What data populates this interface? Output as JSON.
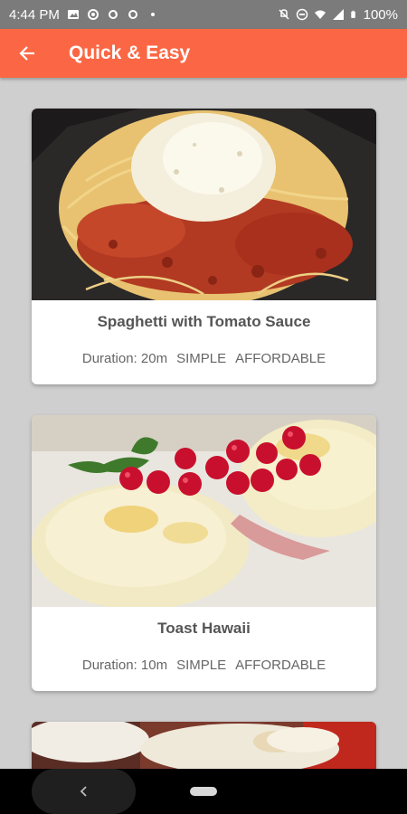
{
  "status_bar": {
    "time": "4:44 PM",
    "battery": "100%",
    "icons_left": [
      "photo-icon",
      "sync-icon",
      "sync-icon",
      "sync-icon",
      "dot-icon"
    ],
    "icons_right": [
      "mute-icon",
      "dnd-icon",
      "wifi-icon",
      "signal-icon",
      "battery-icon"
    ]
  },
  "app_bar": {
    "title": "Quick & Easy",
    "color": "#fb6744",
    "back_icon": "arrow-left-icon"
  },
  "meals": [
    {
      "title": "Spaghetti with Tomato Sauce",
      "duration": "Duration: 20m",
      "complexity": "SIMPLE",
      "affordability": "AFFORDABLE"
    },
    {
      "title": "Toast Hawaii",
      "duration": "Duration: 10m",
      "complexity": "SIMPLE",
      "affordability": "AFFORDABLE"
    }
  ],
  "nav_bar": {
    "back_icon": "chevron-left-icon",
    "home_icon": "home-pill-icon"
  }
}
